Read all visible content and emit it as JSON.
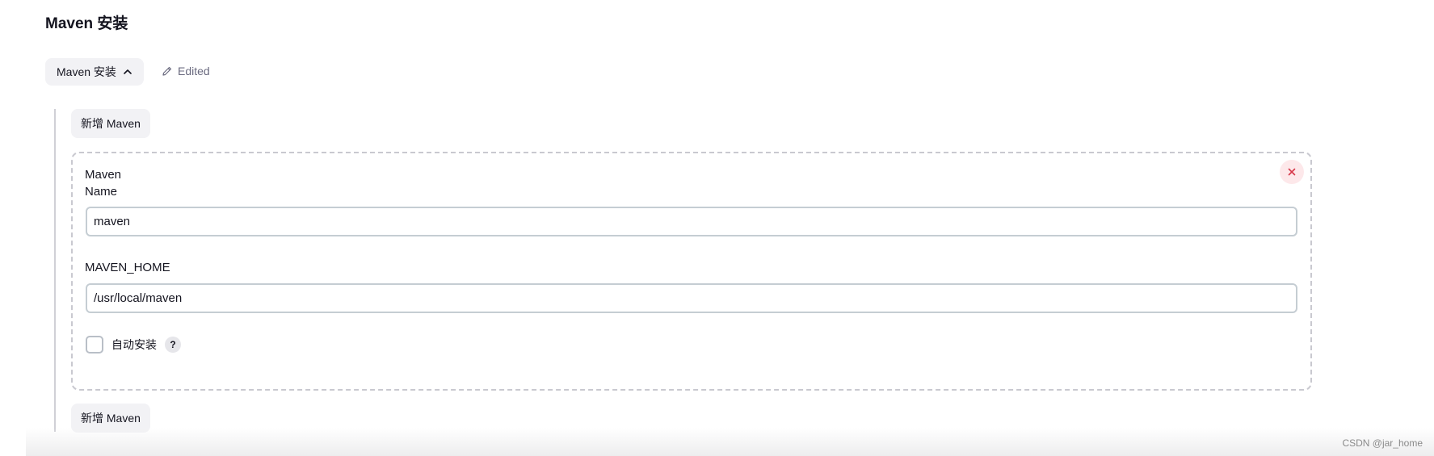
{
  "section": {
    "title": "Maven 安装"
  },
  "toggle": {
    "label": "Maven 安装"
  },
  "status": {
    "edited_label": "Edited"
  },
  "actions": {
    "add_label_top": "新增 Maven",
    "add_label_bottom": "新增 Maven"
  },
  "installation": {
    "name_label": "Maven Name",
    "name_value": "maven",
    "home_label": "MAVEN_HOME",
    "home_value": "/usr/local/maven",
    "auto_install_label": "自动安装",
    "auto_install_checked": false,
    "help_symbol": "?",
    "close_symbol": "×"
  },
  "watermark": {
    "text": "CSDN @jar_home"
  },
  "icons": {
    "toggle": "chevron-up-icon",
    "edited": "pencil-icon",
    "close": "close-icon",
    "help": "help-icon"
  },
  "colors": {
    "close_icon": "#d6394b",
    "close_bg": "#fde8ea",
    "muted_text": "#6b6b80",
    "button_bg": "#f2f2f5"
  }
}
